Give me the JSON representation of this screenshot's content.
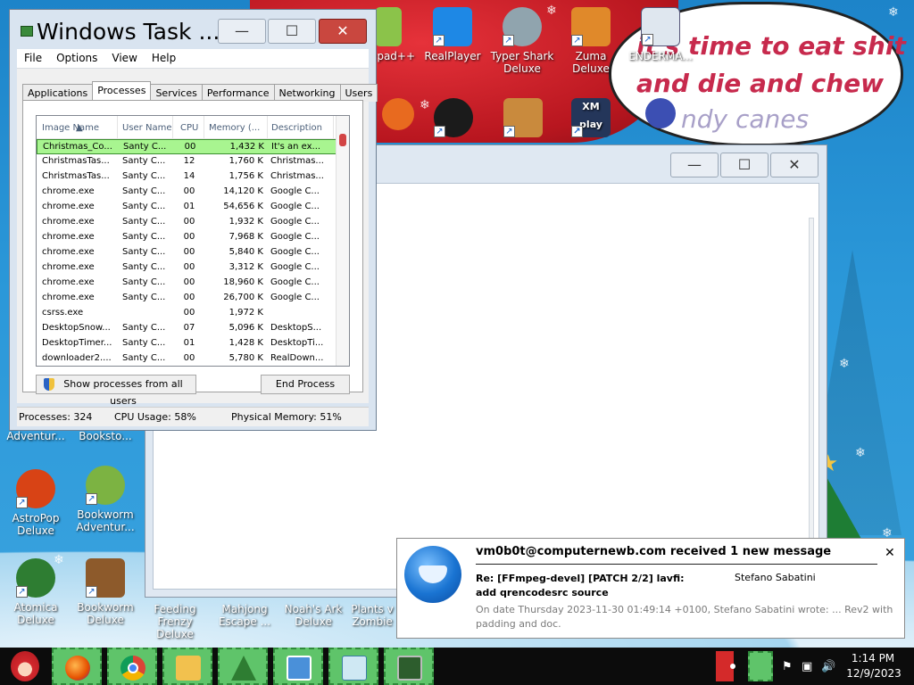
{
  "desktop": {
    "speech_lines": [
      "it's time to eat shit",
      "and die and chew",
      "ndy canes"
    ],
    "icons": {
      "notepad": "epad++",
      "realplayer": "RealPlayer",
      "typer_shark": "Typer Shark Deluxe",
      "zuma": "Zuma Deluxe",
      "enderman": "ENDERMA...",
      "bookworm_adv_top": "Adventur...",
      "bookstore": "Booksto...",
      "astropop": "AstroPop Deluxe",
      "bookworm_adv": "Bookworm Adventur...",
      "atomica": "Atomica Deluxe",
      "bookworm_deluxe": "Bookworm Deluxe",
      "feeding_frenzy": "Feeding Frenzy Deluxe",
      "mahjong": "Mahjong Escape ...",
      "noahs_ark": "Noah's Ark Deluxe",
      "plants_zombies": "Plants v Zombie",
      "xmplay": "XM play"
    }
  },
  "bg_window": {
    "min_label": "—",
    "max_label": "☐",
    "close_label": "✕"
  },
  "taskmgr": {
    "title": "Windows Task ...",
    "min_label": "—",
    "max_label": "☐",
    "close_label": "✕",
    "menu": [
      "File",
      "Options",
      "View",
      "Help"
    ],
    "tabs": [
      "Applications",
      "Processes",
      "Services",
      "Performance",
      "Networking",
      "Users"
    ],
    "active_tab": "Processes",
    "columns": [
      "Image Name",
      "User Name",
      "CPU",
      "Memory (...",
      "Description"
    ],
    "rows": [
      {
        "name": "Christmas_Co...",
        "user": "Santy C...",
        "cpu": "00",
        "mem": "1,432 K",
        "desc": "It's an ex..."
      },
      {
        "name": "ChristmasTas...",
        "user": "Santy C...",
        "cpu": "12",
        "mem": "1,760 K",
        "desc": "Christmas..."
      },
      {
        "name": "ChristmasTas...",
        "user": "Santy C...",
        "cpu": "14",
        "mem": "1,756 K",
        "desc": "Christmas..."
      },
      {
        "name": "chrome.exe",
        "user": "Santy C...",
        "cpu": "00",
        "mem": "14,120 K",
        "desc": "Google C..."
      },
      {
        "name": "chrome.exe",
        "user": "Santy C...",
        "cpu": "01",
        "mem": "54,656 K",
        "desc": "Google C..."
      },
      {
        "name": "chrome.exe",
        "user": "Santy C...",
        "cpu": "00",
        "mem": "1,932 K",
        "desc": "Google C..."
      },
      {
        "name": "chrome.exe",
        "user": "Santy C...",
        "cpu": "00",
        "mem": "7,968 K",
        "desc": "Google C..."
      },
      {
        "name": "chrome.exe",
        "user": "Santy C...",
        "cpu": "00",
        "mem": "5,840 K",
        "desc": "Google C..."
      },
      {
        "name": "chrome.exe",
        "user": "Santy C...",
        "cpu": "00",
        "mem": "3,312 K",
        "desc": "Google C..."
      },
      {
        "name": "chrome.exe",
        "user": "Santy C...",
        "cpu": "00",
        "mem": "18,960 K",
        "desc": "Google C..."
      },
      {
        "name": "chrome.exe",
        "user": "Santy C...",
        "cpu": "00",
        "mem": "26,700 K",
        "desc": "Google C..."
      },
      {
        "name": "csrss.exe",
        "user": "",
        "cpu": "00",
        "mem": "1,972 K",
        "desc": ""
      },
      {
        "name": "DesktopSnow...",
        "user": "Santy C...",
        "cpu": "07",
        "mem": "5,096 K",
        "desc": "DesktopS..."
      },
      {
        "name": "DesktopTimer...",
        "user": "Santy C...",
        "cpu": "01",
        "mem": "1,428 K",
        "desc": "DesktopTi..."
      },
      {
        "name": "downloader2....",
        "user": "Santy C...",
        "cpu": "00",
        "mem": "5,780 K",
        "desc": "RealDown..."
      }
    ],
    "show_all_label": "Show processes from all users",
    "end_process_label": "End Process",
    "status": {
      "processes": "Processes: 324",
      "cpu": "CPU Usage: 58%",
      "memory": "Physical Memory: 51%"
    }
  },
  "notification": {
    "title": "vm0b0t@computernewb.com received 1 new message",
    "close_label": "✕",
    "subject": "Re: [FFmpeg-devel] [PATCH 2/2] lavfi: add qrencodesrc source",
    "sender": "Stefano Sabatini",
    "body": "On date Thursday 2023-11-30 01:49:14 +0100, Stefano Sabatini wrote: ... Rev2 with padding and doc."
  },
  "taskbar": {
    "apps": [
      "firefox-icon",
      "chrome-icon",
      "file-explorer-icon",
      "christmas-tree-icon",
      "image-viewer-icon",
      "notepad-icon",
      "task-manager-icon"
    ],
    "clock_time": "1:14 PM",
    "clock_date": "12/9/2023"
  }
}
